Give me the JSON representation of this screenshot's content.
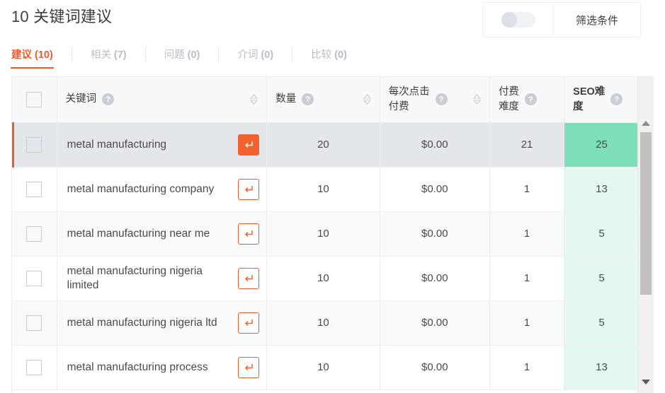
{
  "header": {
    "title": "10 关键词建议",
    "toggle": {
      "name": "results-toggle",
      "state": "off"
    },
    "filter_label": "筛选条件"
  },
  "tabs": [
    {
      "label": "建议",
      "count": "(10)",
      "active": true
    },
    {
      "label": "相关",
      "count": "(7)",
      "active": false
    },
    {
      "label": "问题",
      "count": "(0)",
      "active": false
    },
    {
      "label": "介词",
      "count": "(0)",
      "active": false
    },
    {
      "label": "比较",
      "count": "(0)",
      "active": false
    }
  ],
  "table": {
    "columns": [
      {
        "key": "checkbox",
        "label": "",
        "help": false,
        "sortable": false
      },
      {
        "key": "keyword",
        "label": "关键词",
        "help": true,
        "sortable": true
      },
      {
        "key": "volume",
        "label": "数量",
        "help": true,
        "sortable": true
      },
      {
        "key": "cpc",
        "label": "每次点击\n付费",
        "line1": "每次点击",
        "line2": "付费",
        "help": true,
        "sortable": true
      },
      {
        "key": "paid_difficulty",
        "label": "付费\n难度",
        "line1": "付费",
        "line2": "难度",
        "help": true,
        "sortable": false
      },
      {
        "key": "seo_difficulty",
        "label": "SEO难\n度",
        "line1": "SEO难",
        "line2": "度",
        "help": true,
        "sortable": false,
        "emphasis": true
      }
    ],
    "help_glyph": "?",
    "rows": [
      {
        "keyword": "metal manufacturing",
        "volume": "20",
        "cpc": "$0.00",
        "paid_difficulty": "21",
        "seo_difficulty": "25",
        "selected": true
      },
      {
        "keyword": "metal manufacturing company",
        "volume": "10",
        "cpc": "$0.00",
        "paid_difficulty": "1",
        "seo_difficulty": "13",
        "selected": false
      },
      {
        "keyword": "metal manufacturing near me",
        "volume": "10",
        "cpc": "$0.00",
        "paid_difficulty": "1",
        "seo_difficulty": "5",
        "selected": false
      },
      {
        "keyword": "metal manufacturing nigeria limited",
        "volume": "10",
        "cpc": "$0.00",
        "paid_difficulty": "1",
        "seo_difficulty": "5",
        "selected": false
      },
      {
        "keyword": "metal manufacturing nigeria ltd",
        "volume": "10",
        "cpc": "$0.00",
        "paid_difficulty": "1",
        "seo_difficulty": "5",
        "selected": false
      },
      {
        "keyword": "metal manufacturing process",
        "volume": "10",
        "cpc": "$0.00",
        "paid_difficulty": "1",
        "seo_difficulty": "13",
        "selected": false
      }
    ],
    "row_action_icon": "arrow-redirect-icon"
  },
  "colors": {
    "accent": "#f15a2b",
    "seo_high": "#7ddfb7",
    "seo_low": "#e3f9ef",
    "header_bg": "#f7f8fa",
    "selected_row_bg": "#e3e6ea",
    "muted_text": "#b9bec7"
  }
}
